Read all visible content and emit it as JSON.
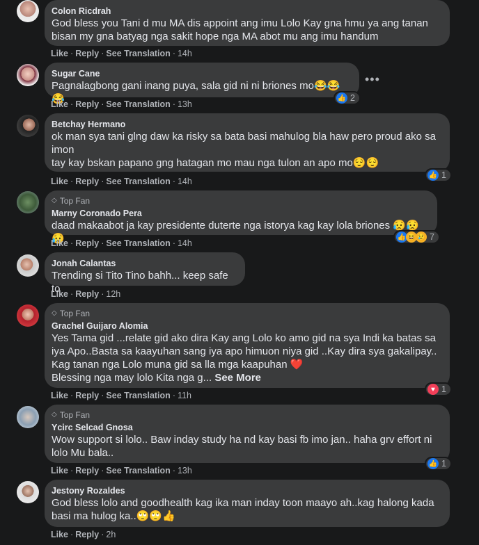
{
  "actions": {
    "like": "Like",
    "reply": "Reply",
    "see_translation": "See Translation",
    "sep": "·"
  },
  "badge": {
    "top_fan": "Top Fan"
  },
  "comments": [
    {
      "author": "Colon Ricdrah",
      "lines": [
        "God bless you Tani d mu MA dis appoint ang imu Lolo Kay gna hmu ya ang tanan",
        "bisan my gna batyag nga sakit hope nga MA abot mu ang imu handum"
      ],
      "time": "14h",
      "translation": true
    },
    {
      "author": "Sugar Cane",
      "lines": [
        "Pagnalagbong gani inang puya, sala gid ni ni briones mo😂😂😂"
      ],
      "time": "13h",
      "translation": true,
      "reaction_count": "2"
    },
    {
      "author": "Betchay Hermano",
      "lines": [
        "ok man sya tani glng daw ka risky sa bata basi mahulog bla haw pero proud ako sa",
        "imon",
        "tay kay bskan papano gng hatagan mo mau nga tulon an apo mo😌😌"
      ],
      "time": "14h",
      "translation": true,
      "reaction_count": "1"
    },
    {
      "author": "Marny Coronado Pera",
      "top_fan": true,
      "lines": [
        "daad makaabot ja kay presidente duterte nga istorya kag kay lola briones 😥😥😥"
      ],
      "time": "14h",
      "translation": true,
      "reaction_count": "7"
    },
    {
      "author": "Jonah Calantas",
      "lines": [
        "Trending si Tito Tino bahh... keep safe to"
      ],
      "time": "12h",
      "translation": false
    },
    {
      "author": "Grachel Guijaro Alomia",
      "top_fan": true,
      "lines": [
        "Yes Tama gid ...relate gid ako dira Kay ang Lolo ko amo gid na sya Indi ka batas sa",
        "iya Apo..Basta sa kaayuhan sang iya apo himuon niya gid ..Kay dira sya gakalipay..",
        "Kag tanan nga Lolo muna gid sa lla mga kaapuhan ❤️",
        "Blessing nga may lolo Kita nga g..."
      ],
      "see_more": "See More",
      "time": "11h",
      "translation": true,
      "reaction_count": "1"
    },
    {
      "author": "Ycirc Selcad Gnosa",
      "top_fan": true,
      "lines": [
        "Wow support si lolo.. Baw inday study ha nd kay basi fb imo jan.. haha grv effort ni",
        "lolo Mu bala.."
      ],
      "time": "13h",
      "translation": true,
      "reaction_count": "1"
    },
    {
      "author": "Jestony Rozaldes",
      "lines": [
        "God bless lolo and goodhealth kag ika man inday toon maayo ah..kag halong kada",
        "basi ma hulog ka..🙄🙄👍"
      ],
      "time": "2h",
      "translation": false
    }
  ]
}
